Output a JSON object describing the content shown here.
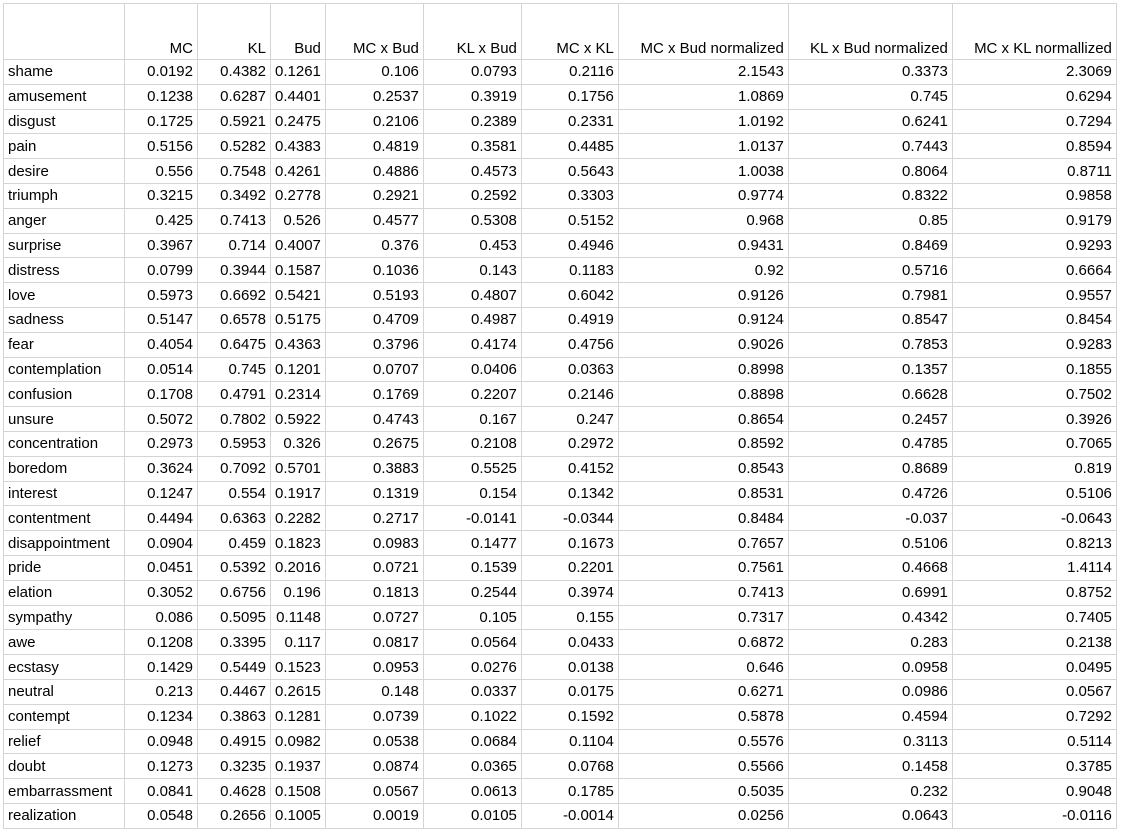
{
  "columns": [
    "",
    "MC",
    "KL",
    "Bud",
    "MC x Bud",
    "KL x Bud",
    "MC x KL",
    "MC x Bud normalized",
    "KL x Bud normalized",
    "MC x KL normallized"
  ],
  "rows": [
    [
      "shame",
      "0.0192",
      "0.4382",
      "0.1261",
      "0.106",
      "0.0793",
      "0.2116",
      "2.1543",
      "0.3373",
      "2.3069"
    ],
    [
      "amusement",
      "0.1238",
      "0.6287",
      "0.4401",
      "0.2537",
      "0.3919",
      "0.1756",
      "1.0869",
      "0.745",
      "0.6294"
    ],
    [
      "disgust",
      "0.1725",
      "0.5921",
      "0.2475",
      "0.2106",
      "0.2389",
      "0.2331",
      "1.0192",
      "0.6241",
      "0.7294"
    ],
    [
      "pain",
      "0.5156",
      "0.5282",
      "0.4383",
      "0.4819",
      "0.3581",
      "0.4485",
      "1.0137",
      "0.7443",
      "0.8594"
    ],
    [
      "desire",
      "0.556",
      "0.7548",
      "0.4261",
      "0.4886",
      "0.4573",
      "0.5643",
      "1.0038",
      "0.8064",
      "0.8711"
    ],
    [
      "triumph",
      "0.3215",
      "0.3492",
      "0.2778",
      "0.2921",
      "0.2592",
      "0.3303",
      "0.9774",
      "0.8322",
      "0.9858"
    ],
    [
      "anger",
      "0.425",
      "0.7413",
      "0.526",
      "0.4577",
      "0.5308",
      "0.5152",
      "0.968",
      "0.85",
      "0.9179"
    ],
    [
      "surprise",
      "0.3967",
      "0.714",
      "0.4007",
      "0.376",
      "0.453",
      "0.4946",
      "0.9431",
      "0.8469",
      "0.9293"
    ],
    [
      "distress",
      "0.0799",
      "0.3944",
      "0.1587",
      "0.1036",
      "0.143",
      "0.1183",
      "0.92",
      "0.5716",
      "0.6664"
    ],
    [
      "love",
      "0.5973",
      "0.6692",
      "0.5421",
      "0.5193",
      "0.4807",
      "0.6042",
      "0.9126",
      "0.7981",
      "0.9557"
    ],
    [
      "sadness",
      "0.5147",
      "0.6578",
      "0.5175",
      "0.4709",
      "0.4987",
      "0.4919",
      "0.9124",
      "0.8547",
      "0.8454"
    ],
    [
      "fear",
      "0.4054",
      "0.6475",
      "0.4363",
      "0.3796",
      "0.4174",
      "0.4756",
      "0.9026",
      "0.7853",
      "0.9283"
    ],
    [
      "contemplation",
      "0.0514",
      "0.745",
      "0.1201",
      "0.0707",
      "0.0406",
      "0.0363",
      "0.8998",
      "0.1357",
      "0.1855"
    ],
    [
      "confusion",
      "0.1708",
      "0.4791",
      "0.2314",
      "0.1769",
      "0.2207",
      "0.2146",
      "0.8898",
      "0.6628",
      "0.7502"
    ],
    [
      "unsure",
      "0.5072",
      "0.7802",
      "0.5922",
      "0.4743",
      "0.167",
      "0.247",
      "0.8654",
      "0.2457",
      "0.3926"
    ],
    [
      "concentration",
      "0.2973",
      "0.5953",
      "0.326",
      "0.2675",
      "0.2108",
      "0.2972",
      "0.8592",
      "0.4785",
      "0.7065"
    ],
    [
      "boredom",
      "0.3624",
      "0.7092",
      "0.5701",
      "0.3883",
      "0.5525",
      "0.4152",
      "0.8543",
      "0.8689",
      "0.819"
    ],
    [
      "interest",
      "0.1247",
      "0.554",
      "0.1917",
      "0.1319",
      "0.154",
      "0.1342",
      "0.8531",
      "0.4726",
      "0.5106"
    ],
    [
      "contentment",
      "0.4494",
      "0.6363",
      "0.2282",
      "0.2717",
      "-0.0141",
      "-0.0344",
      "0.8484",
      "-0.037",
      "-0.0643"
    ],
    [
      "disappointment",
      "0.0904",
      "0.459",
      "0.1823",
      "0.0983",
      "0.1477",
      "0.1673",
      "0.7657",
      "0.5106",
      "0.8213"
    ],
    [
      "pride",
      "0.0451",
      "0.5392",
      "0.2016",
      "0.0721",
      "0.1539",
      "0.2201",
      "0.7561",
      "0.4668",
      "1.4114"
    ],
    [
      "elation",
      "0.3052",
      "0.6756",
      "0.196",
      "0.1813",
      "0.2544",
      "0.3974",
      "0.7413",
      "0.6991",
      "0.8752"
    ],
    [
      "sympathy",
      "0.086",
      "0.5095",
      "0.1148",
      "0.0727",
      "0.105",
      "0.155",
      "0.7317",
      "0.4342",
      "0.7405"
    ],
    [
      "awe",
      "0.1208",
      "0.3395",
      "0.117",
      "0.0817",
      "0.0564",
      "0.0433",
      "0.6872",
      "0.283",
      "0.2138"
    ],
    [
      "ecstasy",
      "0.1429",
      "0.5449",
      "0.1523",
      "0.0953",
      "0.0276",
      "0.0138",
      "0.646",
      "0.0958",
      "0.0495"
    ],
    [
      "neutral",
      "0.213",
      "0.4467",
      "0.2615",
      "0.148",
      "0.0337",
      "0.0175",
      "0.6271",
      "0.0986",
      "0.0567"
    ],
    [
      "contempt",
      "0.1234",
      "0.3863",
      "0.1281",
      "0.0739",
      "0.1022",
      "0.1592",
      "0.5878",
      "0.4594",
      "0.7292"
    ],
    [
      "relief",
      "0.0948",
      "0.4915",
      "0.0982",
      "0.0538",
      "0.0684",
      "0.1104",
      "0.5576",
      "0.3113",
      "0.5114"
    ],
    [
      "doubt",
      "0.1273",
      "0.3235",
      "0.1937",
      "0.0874",
      "0.0365",
      "0.0768",
      "0.5566",
      "0.1458",
      "0.3785"
    ],
    [
      "embarrassment",
      "0.0841",
      "0.4628",
      "0.1508",
      "0.0567",
      "0.0613",
      "0.1785",
      "0.5035",
      "0.232",
      "0.9048"
    ],
    [
      "realization",
      "0.0548",
      "0.2656",
      "0.1005",
      "0.0019",
      "0.0105",
      "-0.0014",
      "0.0256",
      "0.0643",
      "-0.0116"
    ]
  ]
}
